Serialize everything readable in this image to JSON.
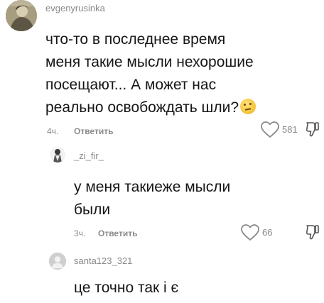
{
  "comment_main": {
    "username": "evgenyrusinka",
    "lines": [
      "что-то в последнее время",
      "меня такие мысли нехорошие",
      "посещают... А может нас",
      "реально освобождать шли?"
    ],
    "emoji_icon": "thinking-face-icon",
    "time": "4ч.",
    "reply_label": "Ответить",
    "likes": "581"
  },
  "reply_1": {
    "username": "_zi_fir_",
    "lines": [
      "у меня такиеже мысли",
      "были"
    ],
    "time": "3ч.",
    "reply_label": "Ответить",
    "likes": "66"
  },
  "reply_2": {
    "username": "santa123_321",
    "lines": [
      "це точно так і є"
    ]
  },
  "colors": {
    "text": "#161616",
    "muted": "#8a8a8a",
    "background": "#ffffff"
  }
}
